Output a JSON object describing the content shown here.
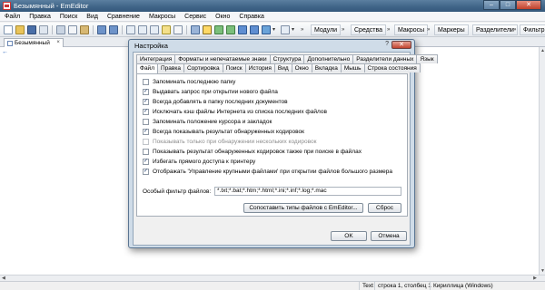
{
  "window": {
    "title": "Безымянный - EmEditor",
    "buttons": {
      "minimize": "–",
      "maximize": "□",
      "close": "✕"
    }
  },
  "menu": [
    "Файл",
    "Правка",
    "Поиск",
    "Вид",
    "Сравнение",
    "Макросы",
    "Сервис",
    "Окно",
    "Справка"
  ],
  "toolbar": {
    "buttons": [
      "Модули",
      "Средства",
      "Макросы",
      "Маркеры",
      "Разделители",
      "Фильтр"
    ]
  },
  "document_tab": {
    "label": "Безымянный",
    "close": "×"
  },
  "editor": {
    "caret_marker": "←"
  },
  "status_bar": {
    "mode": "Text",
    "position": "строка 1, столбец 1",
    "encoding": "Кириллица (Windows)"
  },
  "dialog": {
    "title": "Настройка",
    "help": "?",
    "close": "✕",
    "tabs_row1": [
      "Интеграция",
      "Форматы и непечатаемые знаки",
      "Структура",
      "Дополнительно",
      "Разделители данных",
      "Язык"
    ],
    "tabs_row2": [
      "Файл",
      "Правка",
      "Сортировка",
      "Поиск",
      "История",
      "Вид",
      "Окно",
      "Вкладка",
      "Мышь",
      "Строка состояния"
    ],
    "active_tab": "Файл",
    "options": [
      {
        "label": "Запоминать последнюю папку",
        "checked": false,
        "enabled": true
      },
      {
        "label": "Выдавать запрос при открытии нового файла",
        "checked": true,
        "enabled": true
      },
      {
        "label": "Всегда добавлять в папку последних документов",
        "checked": true,
        "enabled": true
      },
      {
        "label": "Исключать кэш файлы Интернета из списка последних файлов",
        "checked": true,
        "enabled": true
      },
      {
        "label": "Запоминать положение курсора и закладок",
        "checked": false,
        "enabled": true
      },
      {
        "label": "Всегда показывать результат обнаруженных кодировок",
        "checked": true,
        "enabled": true
      },
      {
        "label": "Показывать только при обнаружении нескольких кодировок",
        "checked": false,
        "enabled": false
      },
      {
        "label": "Показывать результат обнаруженных кодировок также при поиске в файлах",
        "checked": false,
        "enabled": true
      },
      {
        "label": "Избегать прямого доступа к принтеру",
        "checked": true,
        "enabled": true
      },
      {
        "label": "Отображать 'Управление крупными файлами' при открытии файлов большого размера",
        "checked": true,
        "enabled": true
      }
    ],
    "filter_label": "Особый фильтр файлов:",
    "filter_value": "*.txt;*.bat;*.htm;*.html;*.ini;*.inf;*.log;*.mac",
    "associate_button": "Сопоставить типы файлов с EmEditor...",
    "reset_button": "Сброс",
    "ok_button": "OK",
    "cancel_button": "Отмена"
  }
}
